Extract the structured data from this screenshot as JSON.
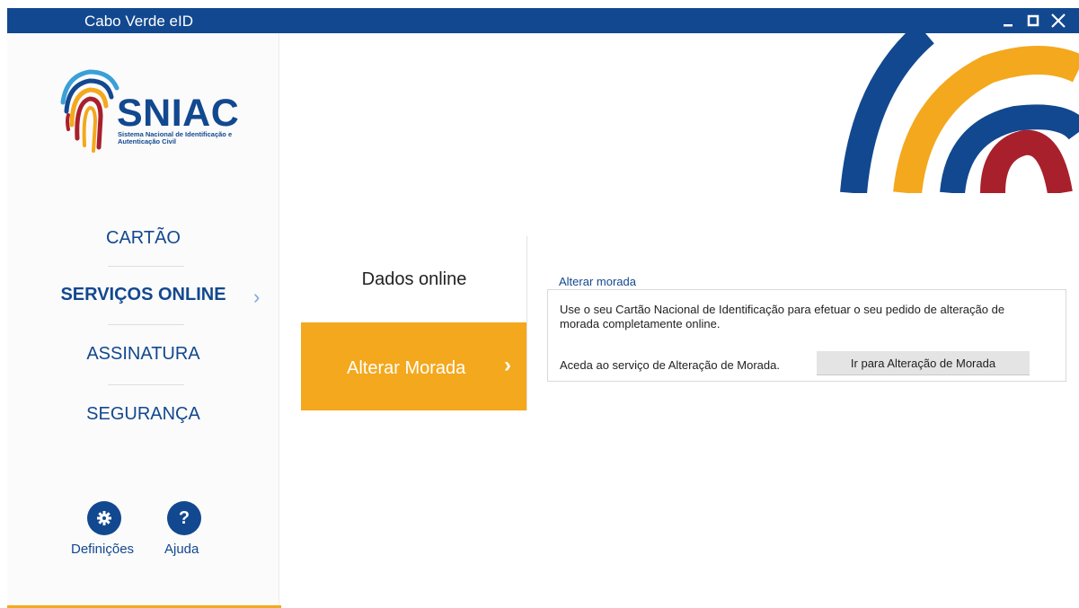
{
  "window": {
    "title": "Cabo Verde eID",
    "controls": [
      "minimize",
      "maximize",
      "close"
    ]
  },
  "logo": {
    "name": "SNIAC",
    "subtitle": "Sistema Nacional de Identificação e Autenticação Civil"
  },
  "nav": {
    "items": [
      {
        "label": "CARTÃO"
      },
      {
        "label": "SERVIÇOS ONLINE",
        "active": true
      },
      {
        "label": "ASSINATURA"
      },
      {
        "label": "SEGURANÇA"
      }
    ],
    "active_chevron": "›"
  },
  "footer": {
    "settings_label": "Definições",
    "help_label": "Ajuda",
    "help_glyph": "?"
  },
  "submenu": {
    "title": "Dados online",
    "active_item": "Alterar Morada",
    "active_chevron": "›"
  },
  "content": {
    "section_title": "Alterar morada",
    "description": "Use o seu Cartão Nacional de Identificação para efetuar o seu pedido de alteração de morada completamente online.",
    "note": "Aceda ao serviço de Alteração de Morada.",
    "button_label": "Ir para Alteração de Morada"
  },
  "colors": {
    "brand_blue": "#12488f",
    "accent_orange": "#f4a81d",
    "accent_red": "#a8202b"
  },
  "icons": {
    "settings": "gear-icon",
    "help": "question-icon",
    "minimize": "minimize-icon",
    "maximize": "maximize-icon",
    "close": "close-icon"
  }
}
